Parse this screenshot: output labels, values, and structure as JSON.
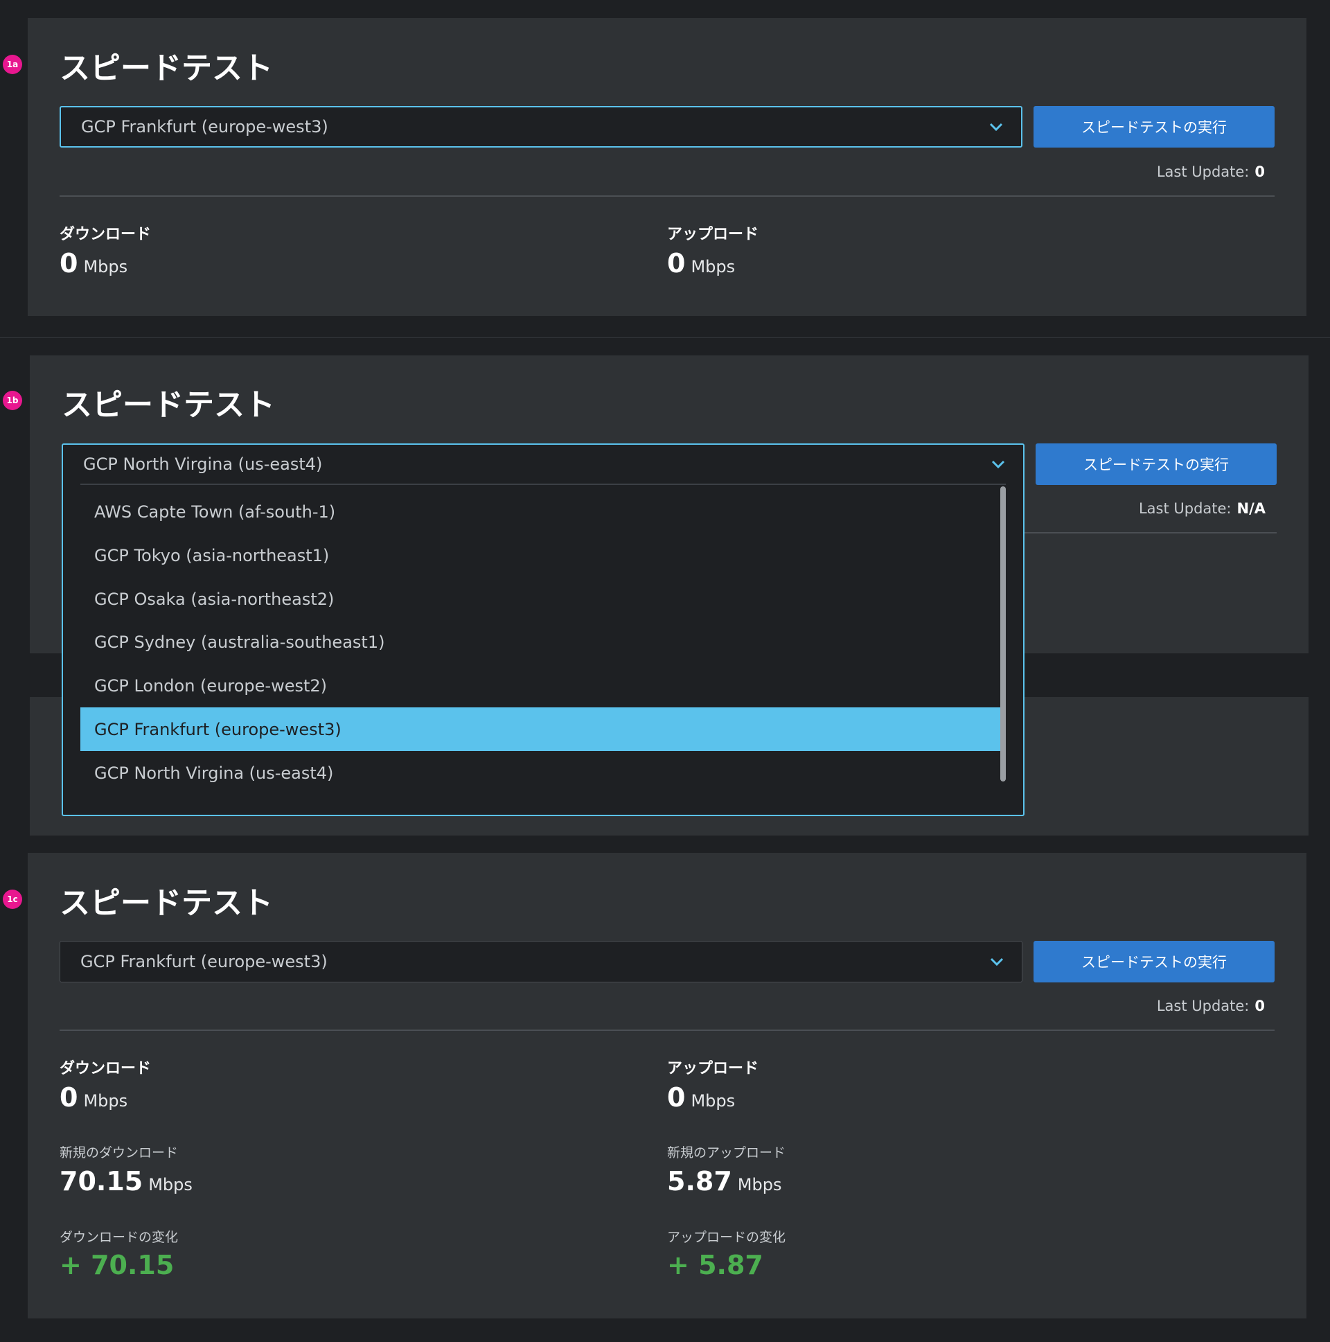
{
  "panels": [
    {
      "badge": "1a",
      "title": "スピードテスト",
      "selected_server": "GCP Frankfurt (europe-west3)",
      "run_label": "スピードテストの実行",
      "last_update_label": "Last Update:",
      "last_update_value": "0",
      "download": {
        "label": "ダウンロード",
        "value": "0",
        "unit": "Mbps"
      },
      "upload": {
        "label": "アップロード",
        "value": "0",
        "unit": "Mbps"
      }
    },
    {
      "badge": "1b",
      "title": "スピードテスト",
      "selected_server": "GCP North Virgina (us-east4)",
      "run_label": "スピードテストの実行",
      "last_update_label": "Last Update:",
      "last_update_value": "N/A",
      "dropdown_options": [
        "AWS Capte Town (af-south-1)",
        "GCP Tokyo (asia-northeast1)",
        "GCP Osaka (asia-northeast2)",
        "GCP Sydney (australia-southeast1)",
        "GCP London (europe-west2)",
        "GCP Frankfurt (europe-west3)",
        "GCP North Virgina (us-east4)"
      ],
      "highlighted_option": "GCP Frankfurt (europe-west3)"
    },
    {
      "badge": "1c",
      "title": "スピードテスト",
      "selected_server": "GCP Frankfurt (europe-west3)",
      "run_label": "スピードテストの実行",
      "last_update_label": "Last Update:",
      "last_update_value": "0",
      "download": {
        "label": "ダウンロード",
        "value": "0",
        "unit": "Mbps"
      },
      "upload": {
        "label": "アップロード",
        "value": "0",
        "unit": "Mbps"
      },
      "new_download": {
        "label": "新規のダウンロード",
        "value": "70.15",
        "unit": "Mbps"
      },
      "new_upload": {
        "label": "新規のアップロード",
        "value": "5.87",
        "unit": "Mbps"
      },
      "download_change": {
        "label": "ダウンロードの変化",
        "value": "+ 70.15"
      },
      "upload_change": {
        "label": "アップロードの変化",
        "value": "+ 5.87"
      }
    }
  ],
  "colors": {
    "page_bg": "#1e2023",
    "card_bg": "#2f3235",
    "accent": "#5bc2ec",
    "button": "#2f7ace",
    "badge": "#e8178f",
    "positive": "#4caf50"
  }
}
